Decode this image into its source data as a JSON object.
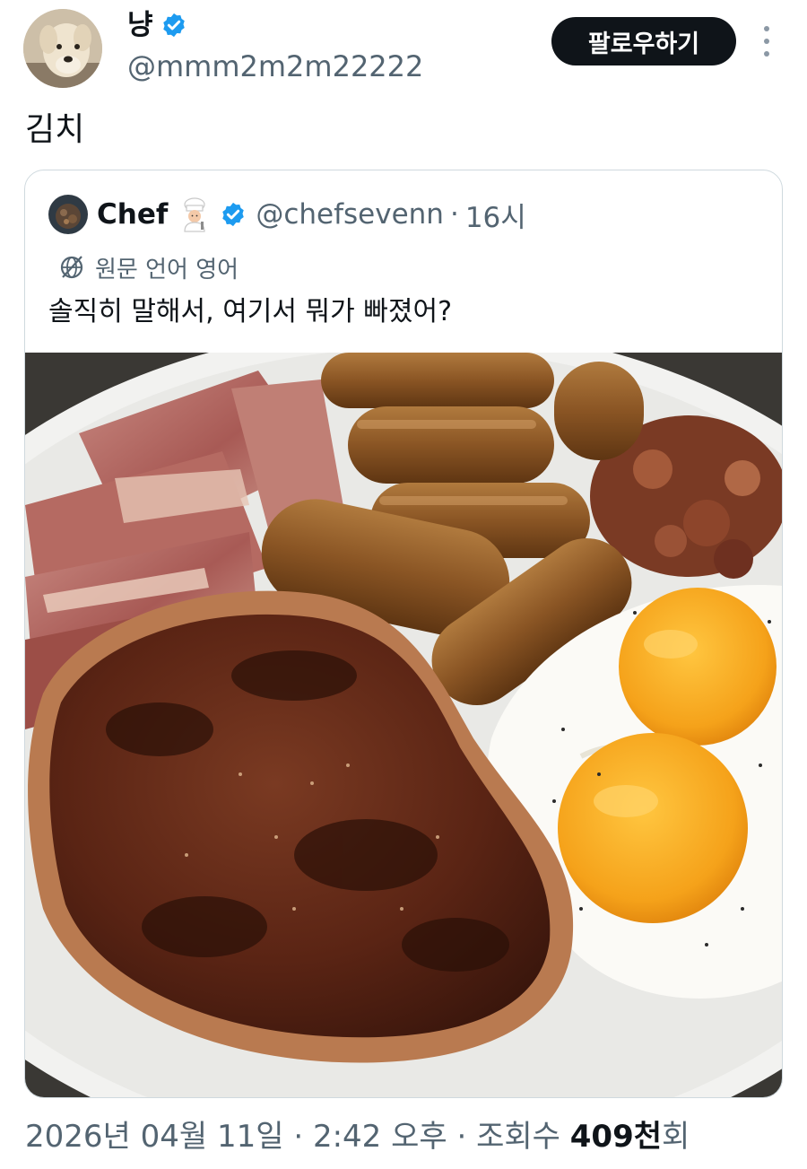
{
  "author": {
    "display_name": "냥",
    "handle": "@mmm2m2m22222",
    "verified": true,
    "avatar": "dog-avatar"
  },
  "follow_label": "팔로우하기",
  "more_icon": "more-vertical-icon",
  "tweet_text": "김치",
  "quote": {
    "author_name": "Chef",
    "author_emoji": "cook-emoji",
    "verified": true,
    "handle": "@chefsevenn",
    "separator": "·",
    "time": "16시",
    "translate_label": "원문 언어 영어",
    "text": "솔직히 말해서, 여기서 뭐가 빠졌어?",
    "image": "breakfast-plate-photo"
  },
  "meta": {
    "date": "2026년 04월 11일",
    "sep1": "·",
    "time": "2:42 오후",
    "sep2": "·",
    "views_label": "조회수",
    "views_count": "409천",
    "views_suffix": "회"
  },
  "colors": {
    "verified": "#1d9bf0",
    "text": "#0f1419",
    "muted": "#536471",
    "border": "#cfd9de",
    "button": "#0f1419"
  }
}
